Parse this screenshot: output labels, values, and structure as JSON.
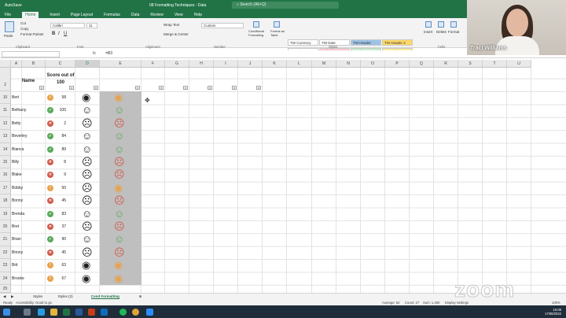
{
  "window": {
    "title": "08 Formatting Techniques - Data",
    "search_placeholder": "Search (Alt+Q)",
    "autosave_label": "AutoSave"
  },
  "ribbon_tabs": [
    "File",
    "Home",
    "Insert",
    "Page Layout",
    "Formulas",
    "Data",
    "Review",
    "View",
    "Help"
  ],
  "ribbon": {
    "paste": "Paste",
    "cut": "Cut",
    "copy": "Copy",
    "format_painter": "Format Painter",
    "clipboard": "Clipboard",
    "font_name": "Calibri",
    "font_size": "11",
    "font_group": "Font",
    "alignment_group": "Alignment",
    "wrap_text": "Wrap Text",
    "merge_center": "Merge & Center",
    "number_format": "Custom",
    "number_group": "Number",
    "conditional_formatting": "Conditional Formatting",
    "format_as_table": "Format as Table",
    "styles_group": "Styles",
    "cells_group": "Cells",
    "insert": "Insert",
    "delete": "Delete",
    "format": "Format",
    "styles": [
      {
        "name": "TW Currency",
        "color": "#ffffff"
      },
      {
        "name": "TW Date",
        "color": "#ffffff"
      },
      {
        "name": "TW Header",
        "color": "#9dc3e6"
      },
      {
        "name": "TW Header 2",
        "color": "#ffd966"
      },
      {
        "name": "Normal",
        "color": "#ffffff"
      },
      {
        "name": "Bad",
        "color": "#ffc7ce"
      },
      {
        "name": "Good",
        "color": "#c6efce"
      },
      {
        "name": "Neutral",
        "color": "#ffeb9c"
      }
    ]
  },
  "formula_bar": {
    "fx": "fx",
    "value": "=B3"
  },
  "columns": [
    "A",
    "B",
    "C",
    "D",
    "E",
    "F",
    "G",
    "H",
    "I",
    "J",
    "K",
    "L",
    "M",
    "N",
    "O",
    "P",
    "Q",
    "R",
    "S",
    "T",
    "U"
  ],
  "headers": {
    "name": "Name",
    "score": "Score out of 100"
  },
  "rows": [
    {
      "row": "10",
      "name": "Bert",
      "score": "58",
      "status": "amber",
      "face": "neutral"
    },
    {
      "row": "11",
      "name": "Bethany",
      "score": "100",
      "status": "green",
      "face": "happy"
    },
    {
      "row": "12",
      "name": "Betty",
      "score": "2",
      "status": "red",
      "face": "sad"
    },
    {
      "row": "13",
      "name": "Beverley",
      "score": "84",
      "status": "green",
      "face": "happy"
    },
    {
      "row": "14",
      "name": "Bianca",
      "score": "89",
      "status": "green",
      "face": "happy"
    },
    {
      "row": "15",
      "name": "Billy",
      "score": "8",
      "status": "red",
      "face": "sad"
    },
    {
      "row": "16",
      "name": "Blake",
      "score": "9",
      "status": "red",
      "face": "sad"
    },
    {
      "row": "17",
      "name": "Bobby",
      "score": "50",
      "status": "amber",
      "face": "sad"
    },
    {
      "row": "18",
      "name": "Bonny",
      "score": "45",
      "status": "red",
      "face": "sad"
    },
    {
      "row": "19",
      "name": "Brenda",
      "score": "83",
      "status": "green",
      "face": "happy"
    },
    {
      "row": "20",
      "name": "Bret",
      "score": "37",
      "status": "red",
      "face": "sad"
    },
    {
      "row": "21",
      "name": "Brian",
      "score": "90",
      "status": "green",
      "face": "happy"
    },
    {
      "row": "22",
      "name": "Briony",
      "score": "45",
      "status": "red",
      "face": "sad"
    },
    {
      "row": "23",
      "name": "Brit",
      "score": "63",
      "status": "amber",
      "face": "neutral"
    },
    {
      "row": "24",
      "name": "Brooke",
      "score": "67",
      "status": "amber",
      "face": "neutral"
    }
  ],
  "colors": {
    "green": "#5aa95a",
    "amber": "#e6a24d",
    "red": "#d05a4a",
    "excel_green": "#217346"
  },
  "sheet_tabs": [
    "Styles",
    "Styles (2)",
    "Cond Formatting"
  ],
  "active_sheet": "Cond Formatting",
  "status": {
    "ready": "Ready",
    "accessibility": "Accessibility: Good to go",
    "average": "Average: 52",
    "count": "Count: 27",
    "sum": "Sum: 1,350",
    "display": "Display Settings",
    "zoom": "100%"
  },
  "clock": {
    "time": "15:08",
    "date": "17/08/2022"
  },
  "video": {
    "name": "Traci Williams"
  },
  "watermark": "zoom"
}
